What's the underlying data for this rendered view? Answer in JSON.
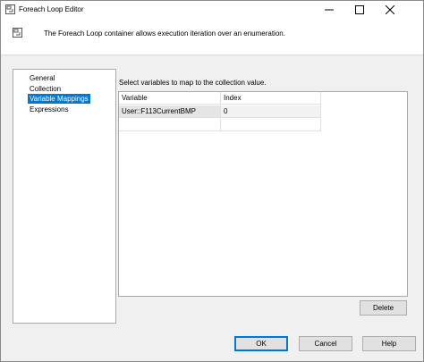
{
  "window": {
    "title": "Foreach Loop Editor"
  },
  "header": {
    "description": "The Foreach Loop container allows execution iteration over an enumeration."
  },
  "nav": {
    "items": [
      {
        "label": "General",
        "selected": false
      },
      {
        "label": "Collection",
        "selected": false
      },
      {
        "label": "Variable Mappings",
        "selected": true
      },
      {
        "label": "Expressions",
        "selected": false
      }
    ]
  },
  "content": {
    "instruction": "Select variables to map to the collection value.",
    "grid": {
      "columns": [
        "Variable",
        "Index"
      ],
      "rows": [
        {
          "variable": "User::F113CurrentBMP",
          "index": "0"
        }
      ]
    }
  },
  "buttons": {
    "delete": "Delete",
    "ok": "OK",
    "cancel": "Cancel",
    "help": "Help"
  },
  "colors": {
    "accent": "#0078d7"
  }
}
